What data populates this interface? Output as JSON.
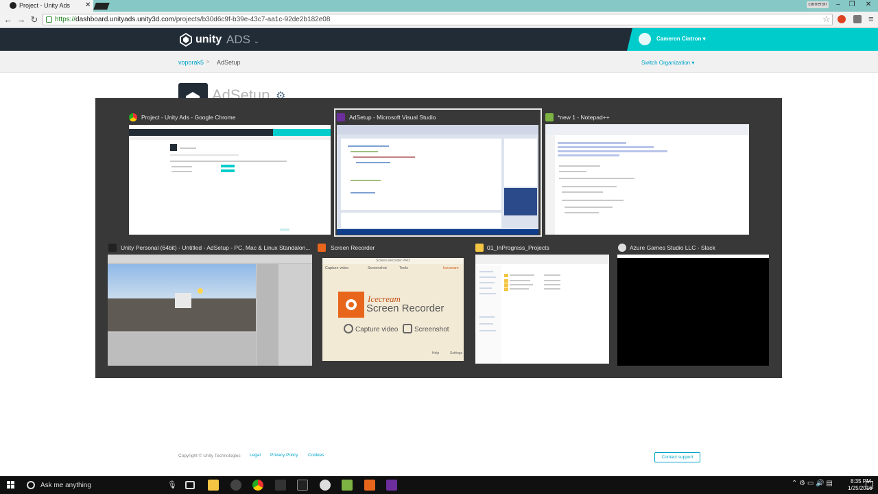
{
  "browser": {
    "tab_title": "Project - Unity Ads",
    "tab_close": "✕",
    "profile": "cameron",
    "url_prefix": "https://",
    "url_domain": "dashboard.unityads.unity3d.com",
    "url_path": "/projects/b30d6c9f-b39e-43c7-aa1c-92de2b182e08",
    "back_icon": "arrow-left-icon",
    "forward_icon": "arrow-right-icon",
    "reload_icon": "reload-icon"
  },
  "header": {
    "logo_text": "unity",
    "product": "ADS",
    "product_caret": "⌄",
    "user_name": "Cameron Cintron",
    "user_caret": "▾"
  },
  "breadcrumb": {
    "org": "voporak5",
    "separator": ">",
    "current": "AdSetup",
    "switch_org": "Switch Organization ▾"
  },
  "project": {
    "title": "AdSetup"
  },
  "switcher": {
    "windows": [
      {
        "title": "Project - Unity Ads - Google Chrome",
        "icon": "chrome-icon"
      },
      {
        "title": "AdSetup - Microsoft Visual Studio",
        "icon": "visual-studio-icon",
        "selected": true
      },
      {
        "title": "*new 1 - Notepad++",
        "icon": "notepad-plus-plus-icon"
      },
      {
        "title": "Unity Personal (64bit) - Untitled - AdSetup - PC, Mac & Linux Standalon...",
        "icon": "unity-icon"
      },
      {
        "title": "Screen Recorder",
        "icon": "screen-recorder-icon"
      },
      {
        "title": "01_InProgress_Projects",
        "icon": "folder-icon"
      },
      {
        "title": "Azure Games Studio LLC - Slack",
        "icon": "slack-icon"
      }
    ],
    "recorder": {
      "window_title": "Screen Recorder PRO",
      "brand_line1": "Icecream",
      "brand_line2": "Screen Recorder",
      "capture_video": "Capture video",
      "screenshot": "Screenshot",
      "small_capture": "Capture video",
      "small_screenshot": "Screenshot",
      "small_tools": "Tools",
      "small_brand": "Icecream",
      "help": "Help",
      "settings": "Settings"
    }
  },
  "footer": {
    "copyright": "Copyright © Unity Technologies",
    "legal": "Legal",
    "privacy": "Privacy Policy",
    "cookies": "Cookies",
    "contact": "Contact support"
  },
  "taskbar": {
    "search_placeholder": "Ask me anything",
    "time": "8:35 PM",
    "date": "1/25/2016"
  },
  "colors": {
    "header_bg": "#222c37",
    "accent": "#00cccc",
    "link": "#00a5c8",
    "switcher_bg": "#383838",
    "taskbar_bg": "#101010"
  }
}
